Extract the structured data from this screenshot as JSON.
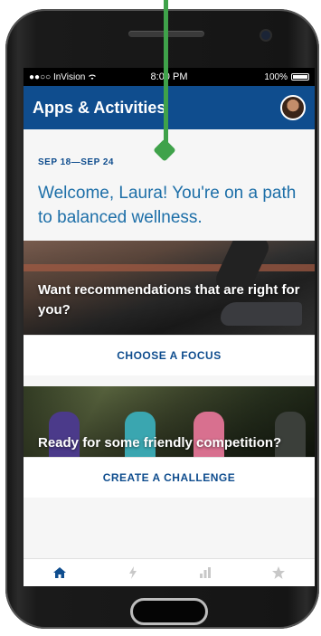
{
  "status_bar": {
    "carrier": "●●○○ InVision",
    "time": "8:00 PM",
    "battery": "100%"
  },
  "app_bar": {
    "title": "Apps & Activities"
  },
  "content": {
    "week_range": "SEP 18—SEP 24",
    "welcome": "Welcome, Laura! You're on a path to balanced wellness."
  },
  "cards": [
    {
      "headline": "Want recommendations that are right for you?",
      "action": "CHOOSE A FOCUS"
    },
    {
      "headline": "Ready for some friendly competition?",
      "action": "CREATE A CHALLENGE"
    }
  ],
  "tabs": [
    {
      "icon": "home-icon",
      "active": true
    },
    {
      "icon": "lightning-icon",
      "active": false
    },
    {
      "icon": "bar-chart-icon",
      "active": false
    },
    {
      "icon": "star-icon",
      "active": false
    }
  ],
  "colors": {
    "primary": "#0f4d8e",
    "accent_text": "#1d6fa8",
    "pointer": "#3fa24a",
    "inactive_icon": "#c8c8c8"
  }
}
